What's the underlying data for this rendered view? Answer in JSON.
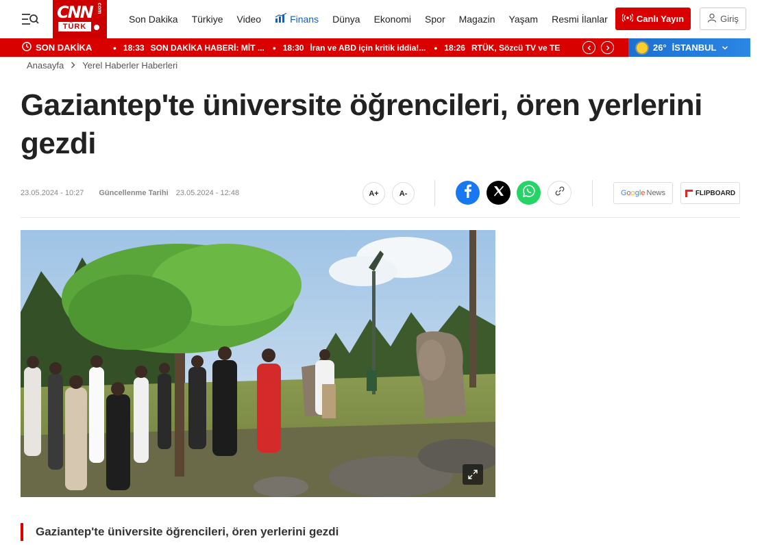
{
  "header": {
    "logo": {
      "brand": "CNN",
      "suffix": "com",
      "country": "TÜRK"
    },
    "nav": [
      {
        "label": "Son Dakika"
      },
      {
        "label": "Türkiye"
      },
      {
        "label": "Video"
      },
      {
        "label": "Finans",
        "icon": "chart-icon"
      },
      {
        "label": "Dünya"
      },
      {
        "label": "Ekonomi"
      },
      {
        "label": "Spor"
      },
      {
        "label": "Magazin"
      },
      {
        "label": "Yaşam"
      },
      {
        "label": "Resmi İlanlar"
      }
    ],
    "live_label": "Canlı Yayın",
    "login_label": "Giriş"
  },
  "ticker": {
    "label": "SON DAKİKA",
    "items": [
      {
        "time": "18:33",
        "text": "SON DAKİKA HABERİ: MİT ..."
      },
      {
        "time": "18:30",
        "text": "İran ve ABD için kritik iddia!..."
      },
      {
        "time": "18:26",
        "text": "RTÜK, Sözcü TV ve TE"
      }
    ]
  },
  "weather": {
    "temp": "26°",
    "city": "İSTANBUL"
  },
  "breadcrumb": {
    "home": "Anasayfa",
    "section": "Yerel Haberler Haberleri"
  },
  "article": {
    "title": "Gaziantep'te üniversite öğrencileri, ören yerlerini gezdi",
    "published": "23.05.2024 - 10:27",
    "updated_label": "Güncellenme Tarihi",
    "updated": "23.05.2024 - 12:48",
    "font_increase": "A+",
    "font_decrease": "A-",
    "google_news": {
      "g1": "G",
      "g2": "o",
      "g3": "o",
      "g4": "g",
      "g5": "l",
      "g6": "e",
      "rest": "News"
    },
    "flipboard": "FLIPBOARD",
    "caption": "Gaziantep'te üniversite öğrencileri, ören yerlerini gezdi"
  },
  "colors": {
    "brand_red": "#d90000",
    "finans_blue": "#1a5fb4",
    "weather_blue": "#1d6fd0"
  }
}
